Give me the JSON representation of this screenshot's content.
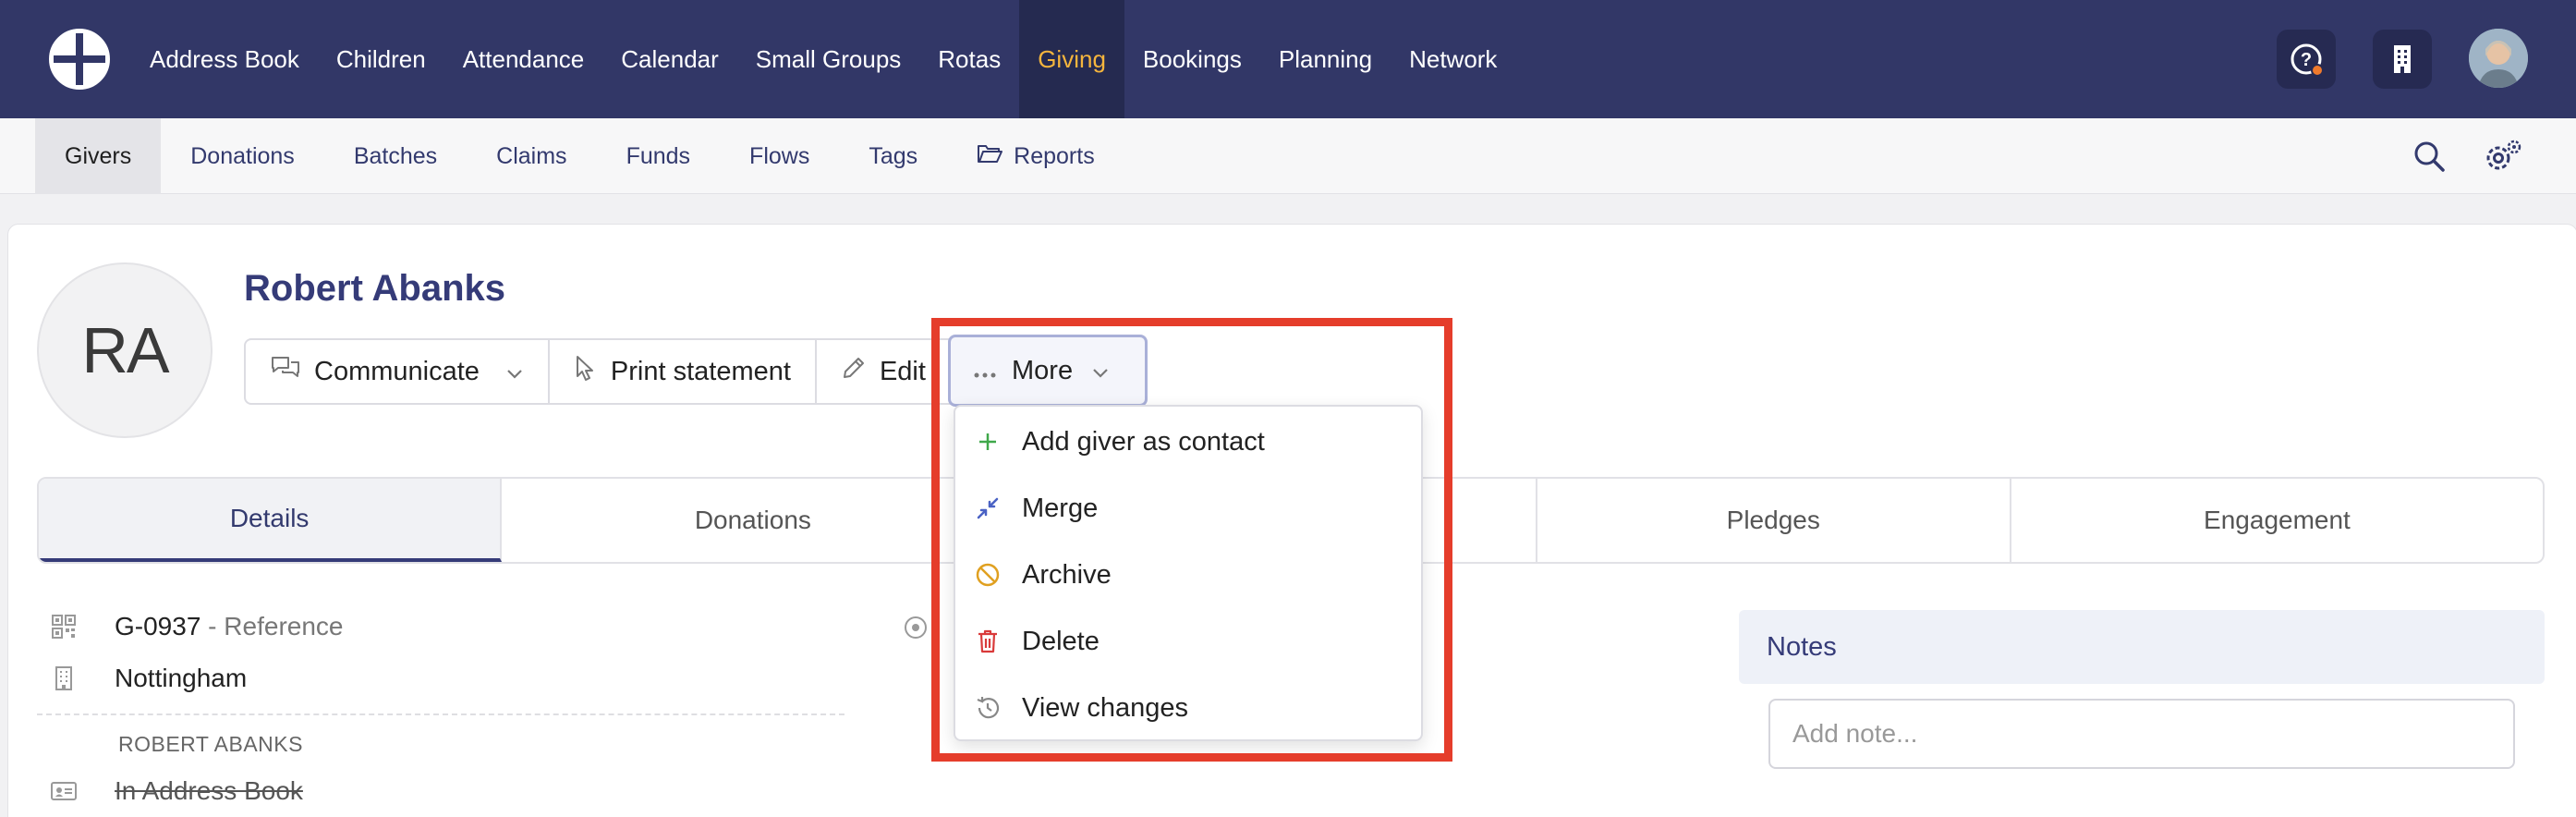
{
  "topnav": {
    "items": [
      "Address Book",
      "Children",
      "Attendance",
      "Calendar",
      "Small Groups",
      "Rotas",
      "Giving",
      "Bookings",
      "Planning",
      "Network"
    ],
    "active": "Giving",
    "icons": [
      "help-icon",
      "building-icon",
      "avatar-photo"
    ]
  },
  "subnav": {
    "items": [
      "Givers",
      "Donations",
      "Batches",
      "Claims",
      "Funds",
      "Flows",
      "Tags",
      "Reports"
    ],
    "active": "Givers",
    "right_icons": [
      "search-icon",
      "settings-icon"
    ]
  },
  "profile": {
    "initials": "RA",
    "name": "Robert Abanks"
  },
  "actions": {
    "communicate": "Communicate",
    "print_statement": "Print statement",
    "edit": "Edit",
    "more": "More"
  },
  "dropdown": {
    "items": [
      {
        "label": "Add giver as contact",
        "icon": "plus-icon",
        "color": "#3fa84a"
      },
      {
        "label": "Merge",
        "icon": "merge-icon",
        "color": "#4a62c4"
      },
      {
        "label": "Archive",
        "icon": "archive-icon",
        "color": "#e0a020"
      },
      {
        "label": "Delete",
        "icon": "trash-icon",
        "color": "#d93a3a"
      },
      {
        "label": "View changes",
        "icon": "history-icon",
        "color": "#888888"
      }
    ]
  },
  "tabs": [
    "Details",
    "Donations",
    "",
    "Pledges",
    "Engagement"
  ],
  "details": {
    "reference_id": "G-0937",
    "reference_sep": " - ",
    "reference_label": "Reference",
    "city": "Nottingham",
    "section_label": "ROBERT ABANKS",
    "address_book_status": "In Address Book"
  },
  "notes": {
    "title": "Notes",
    "placeholder": "Add note..."
  },
  "colors": {
    "nav_bg": "#323767",
    "nav_active_text": "#f5b53d",
    "accent": "#353b78",
    "highlight": "#e53d2b"
  }
}
